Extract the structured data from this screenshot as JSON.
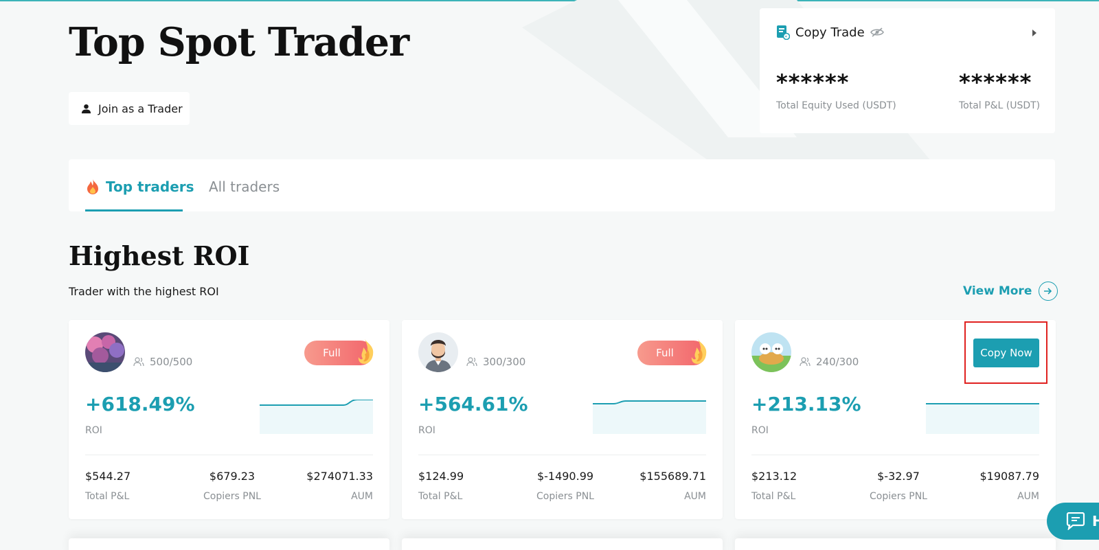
{
  "page": {
    "title": "Top Spot Trader",
    "join_label": "Join as a Trader"
  },
  "copy_trade": {
    "label": "Copy Trade",
    "equity_value": "******",
    "equity_caption": "Total Equity Used (USDT)",
    "pnl_value": "******",
    "pnl_caption": "Total P&L  (USDT)"
  },
  "tabs": [
    {
      "label": "Top traders",
      "active": true
    },
    {
      "label": "All traders",
      "active": false
    }
  ],
  "section": {
    "title": "Highest ROI",
    "subtitle": "Trader with the highest ROI",
    "view_more": "View More"
  },
  "cards": [
    {
      "followers": "500/500",
      "status": "Full",
      "roi": "+618.49%",
      "roi_label": "ROI",
      "total_pnl": "$544.27",
      "total_pnl_label": "Total P&L",
      "copiers_pnl": "$679.23",
      "copiers_pnl_label": "Copiers PNL",
      "aum": "$274071.33",
      "aum_label": "AUM"
    },
    {
      "followers": "300/300",
      "status": "Full",
      "roi": "+564.61%",
      "roi_label": "ROI",
      "total_pnl": "$124.99",
      "total_pnl_label": "Total P&L",
      "copiers_pnl": "$-1490.99",
      "copiers_pnl_label": "Copiers PNL",
      "aum": "$155689.71",
      "aum_label": "AUM"
    },
    {
      "followers": "240/300",
      "action": "Copy Now",
      "roi": "+213.13%",
      "roi_label": "ROI",
      "total_pnl": "$213.12",
      "total_pnl_label": "Total P&L",
      "copiers_pnl": "$-32.97",
      "copiers_pnl_label": "Copiers PNL",
      "aum": "$19087.79",
      "aum_label": "AUM"
    }
  ],
  "help": {
    "label": "H"
  },
  "colors": {
    "accent": "#1c9eb1",
    "full_badge": "#f2656b",
    "highlight": "#e0211f"
  }
}
